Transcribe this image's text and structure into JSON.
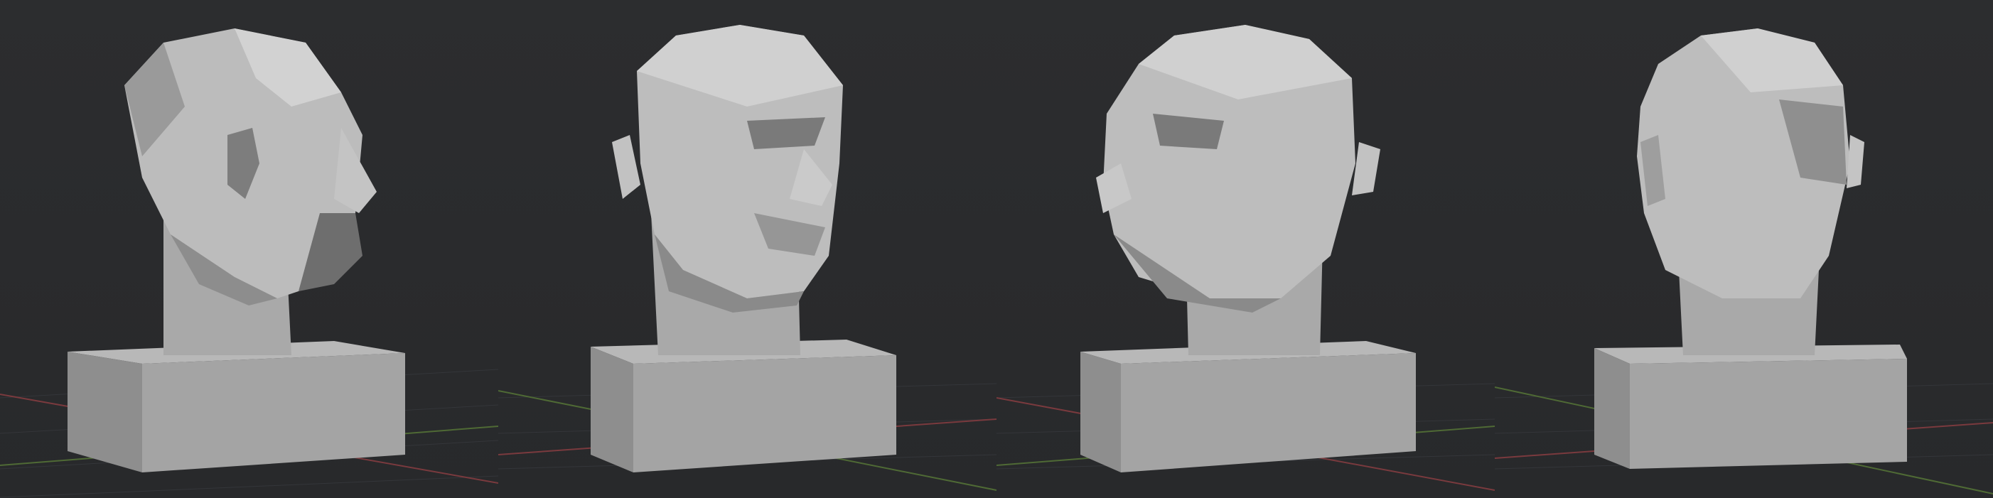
{
  "scene": {
    "description_free": true,
    "viewports": [
      {
        "view": "right-three-quarter-back"
      },
      {
        "view": "front-right-three-quarter"
      },
      {
        "view": "front-left-three-quarter"
      },
      {
        "view": "back-left-three-quarter"
      }
    ],
    "colors": {
      "background": "#2a2b2d",
      "grid_line": "#34363a",
      "x_axis": "#7a3a3e",
      "y_axis": "#4f6a35",
      "clay_light": "#c8c8c8",
      "clay_mid": "#a9a9a9",
      "clay_dark": "#6e6e6e",
      "pedestal_top": "#b8b8b8",
      "pedestal_front": "#a4a4a4",
      "pedestal_side": "#8e8e8e"
    }
  }
}
